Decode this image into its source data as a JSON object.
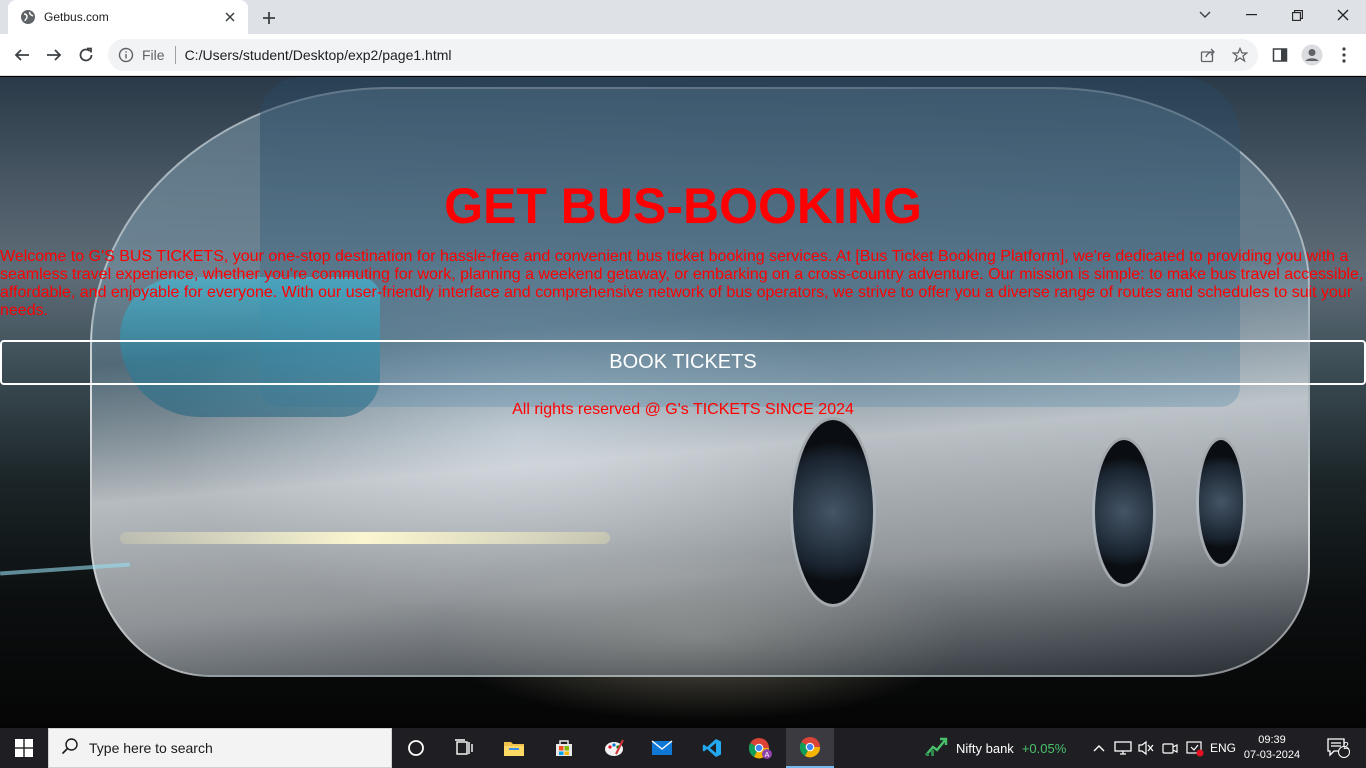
{
  "browser": {
    "tab_title": "Getbus.com",
    "url_scheme": "File",
    "url": "C:/Users/student/Desktop/exp2/page1.html",
    "icons": [
      "globe-icon",
      "close-icon",
      "plus-icon",
      "chevron-down-icon",
      "minimize-icon",
      "restore-icon",
      "back-icon",
      "forward-icon",
      "reload-icon",
      "info-icon",
      "share-icon",
      "star-icon",
      "side-panel-icon",
      "profile-icon",
      "more-icon"
    ]
  },
  "page": {
    "heading": "GET BUS-BOOKING",
    "intro": "Welcome to G'S BUS TICKETS, your one-stop destination for hassle-free and convenient bus ticket booking services. At [Bus Ticket Booking Platform], we're dedicated to providing you with a seamless travel experience, whether you're commuting for work, planning a weekend getaway, or embarking on a cross-country adventure. Our mission is simple: to make bus travel accessible, affordable, and enjoyable for everyone. With our user-friendly interface and comprehensive network of bus operators, we strive to offer you a diverse range of routes and schedules to suit your needs.",
    "book_button": "BOOK TICKETS",
    "footer": "All rights reserved @ G's TICKETS SINCE 2024",
    "colors": {
      "text_accent": "#ff0000",
      "button_text": "#ffffff"
    }
  },
  "taskbar": {
    "search_placeholder": "Type here to search",
    "nifty_label": "Nifty bank",
    "nifty_value": "+0.05%",
    "language": "ENG",
    "time": "09:39",
    "date": "07-03-2024",
    "notifications": "2"
  }
}
